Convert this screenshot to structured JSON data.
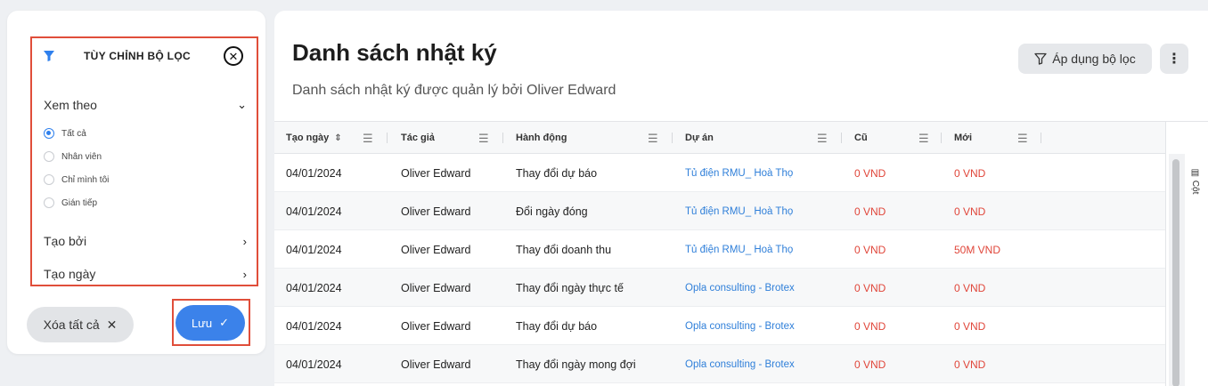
{
  "filter_panel": {
    "title": "TÙY CHỈNH BỘ LỌC",
    "view_by": {
      "label": "Xem theo",
      "options": [
        "Tất cả",
        "Nhân viên",
        "Chỉ mình tôi",
        "Gián tiếp"
      ],
      "selected": "Tất cả"
    },
    "created_by_label": "Tạo bởi",
    "created_date_label": "Tạo ngày",
    "clear_all_label": "Xóa tất cả",
    "save_label": "Lưu"
  },
  "main": {
    "title": "Danh sách nhật ký",
    "subtitle": "Danh sách nhật ký được quản lý bởi Oliver Edward",
    "apply_filter_label": "Áp dụng bộ lọc",
    "columns_tab_label": "Cột"
  },
  "table": {
    "columns": [
      "Tạo ngày",
      "Tác giả",
      "Hành động",
      "Dự án",
      "Cũ",
      "Mới"
    ],
    "rows": [
      [
        "04/01/2024",
        "Oliver Edward",
        "Thay đổi dự báo",
        "Tủ điện RMU_ Hoà Thọ",
        "0 VND",
        "0 VND"
      ],
      [
        "04/01/2024",
        "Oliver Edward",
        "Đổi ngày đóng",
        "Tủ điện RMU_ Hoà Thọ",
        "0 VND",
        "0 VND"
      ],
      [
        "04/01/2024",
        "Oliver Edward",
        "Thay đổi doanh thu",
        "Tủ điện RMU_ Hoà Thọ",
        "0 VND",
        "50M VND"
      ],
      [
        "04/01/2024",
        "Oliver Edward",
        "Thay đổi ngày thực tế",
        "Opla consulting - Brotex",
        "0 VND",
        "0 VND"
      ],
      [
        "04/01/2024",
        "Oliver Edward",
        "Thay đổi dự báo",
        "Opla consulting - Brotex",
        "0 VND",
        "0 VND"
      ],
      [
        "04/01/2024",
        "Oliver Edward",
        "Thay đổi ngày mong đợi",
        "Opla consulting - Brotex",
        "0 VND",
        "0 VND"
      ]
    ]
  },
  "colors": {
    "accent": "#3b82ea",
    "link": "#2f7fd9",
    "negative": "#e0463a",
    "highlight_border": "#e04e3a"
  }
}
